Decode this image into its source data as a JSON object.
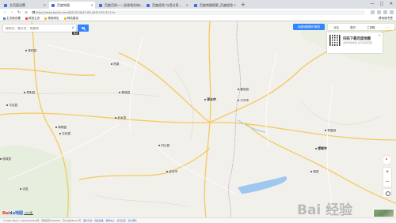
{
  "browser": {
    "tabs": [
      {
        "label": "主页面设置",
        "active": false
      },
      {
        "label": "百度地图",
        "active": true
      },
      {
        "label": "百度百科——全球领先的...",
        "active": false
      },
      {
        "label": "百度经验-与您分享...",
        "active": false
      },
      {
        "label": "百度地图搜索_百度经验",
        "active": false
      }
    ],
    "new_tab": "+",
    "window_controls": [
      "—",
      "□",
      "✕"
    ],
    "url": "https://map.baidu.com/@12913447.69,4431235.97,11z",
    "bookmarks": [
      {
        "label": "主页面设置",
        "icon": "folder-icon",
        "color": "#4a7ee0"
      },
      {
        "label": "新浪主页",
        "icon": "sina-icon",
        "color": "#d94c3d"
      },
      {
        "label": "常用网址",
        "icon": "folder-icon",
        "color": "#e9b93c"
      },
      {
        "label": "网站建设",
        "icon": "folder-icon",
        "color": "#e9b93c"
      }
    ],
    "bookmarks_right": "移动版书签"
  },
  "map": {
    "search_placeholder": "搜地点、查公交、找路线",
    "tooltip": "路线",
    "route_button": "百度地图随行服务",
    "top_tools": [
      "北京",
      "路况",
      "工具箱",
      "..."
    ],
    "qr": {
      "title": "扫码下载百度地图",
      "subtitle": "全新导航体验 出行就用百度"
    },
    "cities": [
      {
        "name": "昔阳县",
        "big": false
      },
      {
        "name": "阳泉",
        "big": false
      },
      {
        "name": "平定县",
        "big": false
      },
      {
        "name": "寿阳县",
        "big": false
      },
      {
        "name": "和顺县",
        "big": false
      },
      {
        "name": "左权县",
        "big": false
      },
      {
        "name": "黎城县",
        "big": false
      },
      {
        "name": "武乡县",
        "big": false
      },
      {
        "name": "襄垣县",
        "big": false
      },
      {
        "name": "邢台市",
        "big": true
      },
      {
        "name": "沙河市",
        "big": false
      },
      {
        "name": "内丘县",
        "big": false
      },
      {
        "name": "武安市",
        "big": false
      },
      {
        "name": "临城县",
        "big": false
      },
      {
        "name": "赞皇县",
        "big": false
      },
      {
        "name": "邯郸市",
        "big": true
      },
      {
        "name": "涉县",
        "big": false
      },
      {
        "name": "磁县",
        "big": false
      }
    ],
    "scale": "10公里",
    "watermark": "Bai 经验",
    "logo": {
      "bai": "Bai",
      "du": "du地图"
    }
  },
  "footer": {
    "text": "© 2021 Baidu - GS(2019)5218号 - 甲测资字1100930 - 京ICP证030173号",
    "links": [
      "服务条款",
      "隐私政策",
      "帮助中心",
      "意见反馈",
      "商户服务"
    ]
  },
  "colors": {
    "accent": "#3385ff",
    "map_bg": "#f2f0eb",
    "road": "#f7d57a",
    "water": "#9fc7f0",
    "green": "#cfe4c3"
  }
}
